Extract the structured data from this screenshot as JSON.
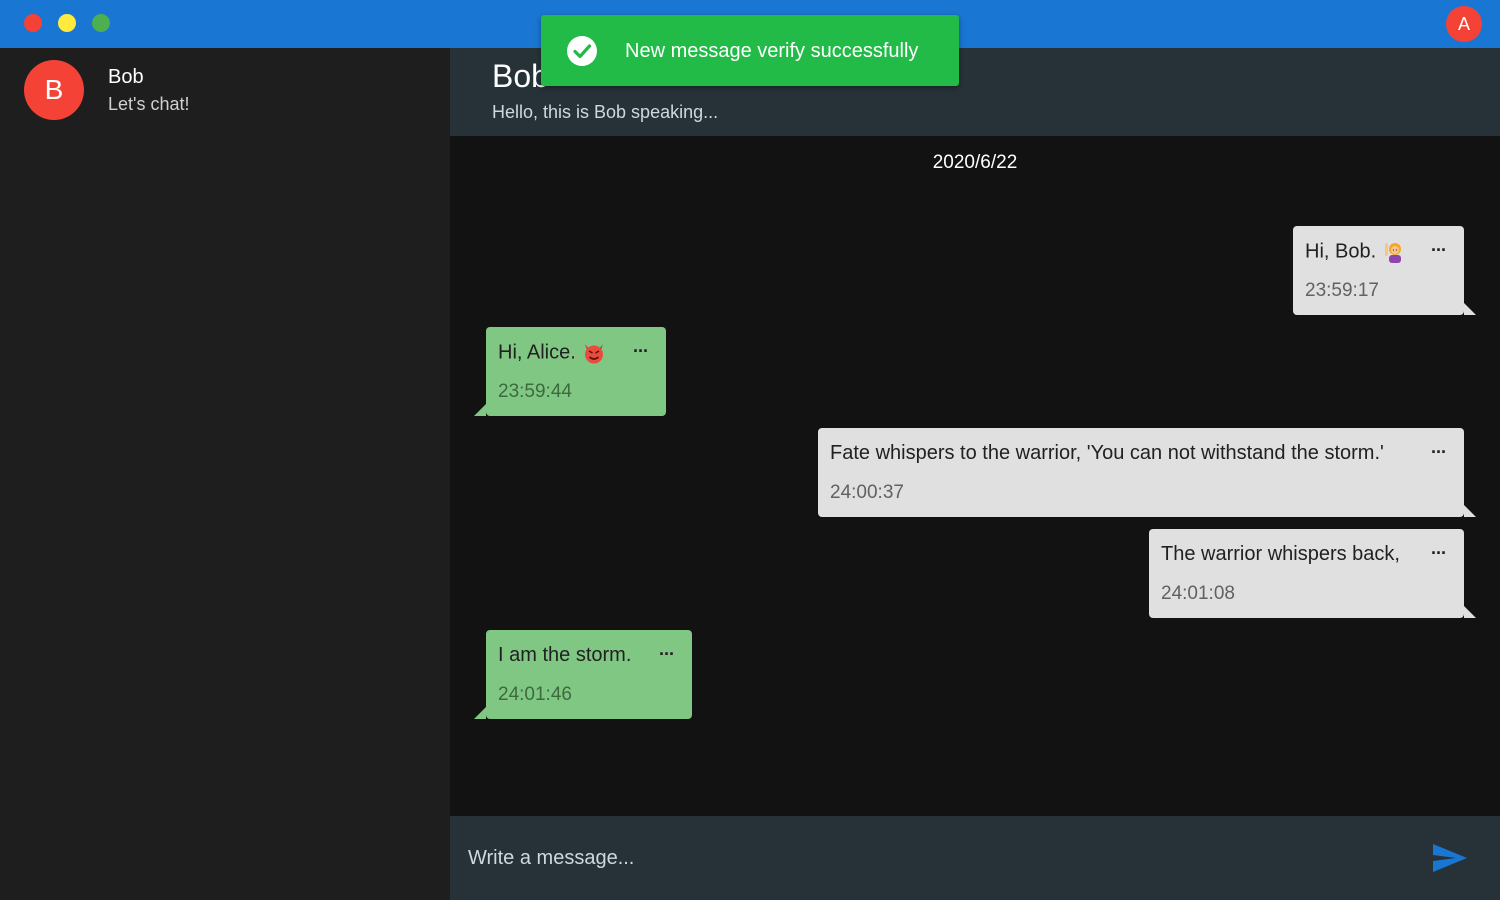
{
  "titlebar": {
    "avatar_letter": "A",
    "colors": {
      "bar": "#1976d2",
      "close": "#f44336",
      "minimize": "#ffeb3b",
      "maximize": "#4caf50"
    }
  },
  "sidebar": {
    "contacts": [
      {
        "avatar_letter": "B",
        "name": "Bob",
        "status": "Let's chat!"
      }
    ]
  },
  "chat": {
    "title": "Bob",
    "subtitle": "Hello, this is Bob speaking...",
    "date": "2020/6/22",
    "messages": [
      {
        "side": "sent",
        "text": "Hi, Bob.",
        "emoji": "woman-raising-hand-emoji",
        "time": "23:59:17"
      },
      {
        "side": "recv",
        "text": "Hi, Alice.",
        "emoji": "smiling-devil-emoji",
        "time": "23:59:44"
      },
      {
        "side": "sent",
        "text": "Fate whispers to the warrior, 'You can not withstand the storm.'",
        "time": "24:00:37"
      },
      {
        "side": "sent",
        "text": "The warrior whispers back,",
        "time": "24:01:08"
      },
      {
        "side": "recv",
        "text": "I am the storm.",
        "time": "24:01:46"
      }
    ],
    "more_label": "···"
  },
  "composer": {
    "placeholder": "Write a message...",
    "send_icon": "send-icon",
    "accent": "#1976d2"
  },
  "toast": {
    "message": "New message verify successfully",
    "icon": "check-circle-icon",
    "color": "#22bb48"
  }
}
